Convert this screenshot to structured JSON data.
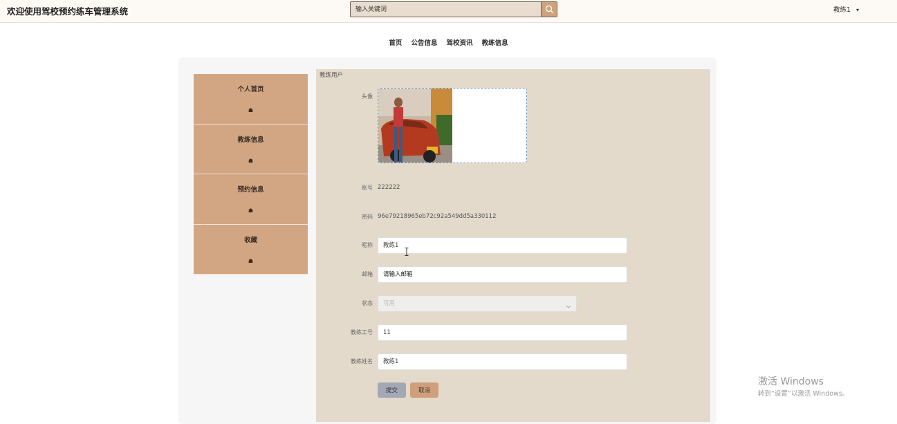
{
  "header": {
    "title": "欢迎使用驾校预约练车管理系统",
    "search_placeholder": "输入关键词",
    "search_icon": "search-icon",
    "user_name": "教练1",
    "user_caret": "▾"
  },
  "nav": [
    "首页",
    "公告信息",
    "驾校资讯",
    "教练信息"
  ],
  "sidebar": {
    "items": [
      {
        "label": "个人首页",
        "icon": "☗"
      },
      {
        "label": "教练信息",
        "icon": "☗"
      },
      {
        "label": "预约信息",
        "icon": "☗"
      },
      {
        "label": "收藏",
        "icon": "☗"
      }
    ]
  },
  "form": {
    "section_title": "教练用户",
    "avatar_label": "头像",
    "account_label": "账号",
    "account_value": "222222",
    "password_label": "密码",
    "password_value": "96e79218965eb72c92a549dd5a330112",
    "nickname_label": "昵称",
    "nickname_value": "教练1",
    "email_label": "邮箱",
    "email_placeholder": "请输入邮箱",
    "status_label": "状态",
    "status_value": "可用",
    "coach_no_label": "教练工号",
    "coach_no_value": "11",
    "coach_name_label": "教练姓名",
    "coach_name_value": "教练1",
    "submit_label": "提交",
    "cancel_label": "取消"
  },
  "watermark": {
    "line1": "激活 Windows",
    "line2": "转到“设置”以激活 Windows。"
  }
}
